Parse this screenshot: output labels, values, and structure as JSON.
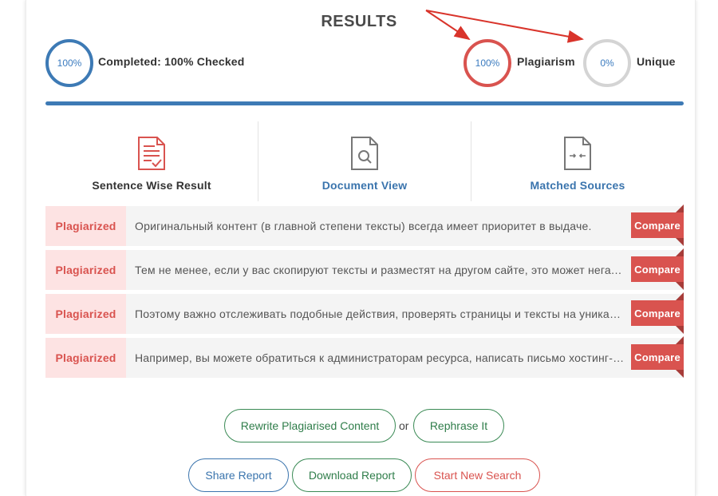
{
  "title": "RESULTS",
  "stats": {
    "completed_value": "100%",
    "completed_label": "Completed: 100% Checked",
    "completed_fraction": 1.0,
    "plagiarism_value": "100%",
    "plagiarism_label": "Plagiarism",
    "unique_value": "0%",
    "unique_label": "Unique"
  },
  "tabs": [
    {
      "label": "Sentence Wise Result",
      "icon": "document-check-icon"
    },
    {
      "label": "Document View",
      "icon": "document-search-icon"
    },
    {
      "label": "Matched Sources",
      "icon": "document-compare-icon"
    }
  ],
  "rows": [
    {
      "status": "Plagiarized",
      "text": "Оригинальный контент (в главной степени тексты) всегда имеет приоритет в выдаче.",
      "action": "Compare"
    },
    {
      "status": "Plagiarized",
      "text": "Тем не менее, если у вас скопируют тексты и разместят на другом сайте, это может негативно сказаться на вашем сайте.",
      "action": "Compare"
    },
    {
      "status": "Plagiarized",
      "text": "Поэтому важно отслеживать подобные действия, проверять страницы и тексты на уникальность.",
      "action": "Compare"
    },
    {
      "status": "Plagiarized",
      "text": "Например, вы можете обратиться к администраторам ресурса, написать письмо хостинг-провайдеру.",
      "action": "Compare"
    }
  ],
  "actions": {
    "rewrite": "Rewrite Plagiarised Content",
    "or": "or",
    "rephrase": "Rephrase It",
    "share": "Share Report",
    "download": "Download Report",
    "new_search": "Start New Search"
  },
  "colors": {
    "accent_blue": "#3d7ab5",
    "plagiarism_red": "#d9534f",
    "unique_gray": "#d4d4d4",
    "green": "#2f7d4a"
  }
}
